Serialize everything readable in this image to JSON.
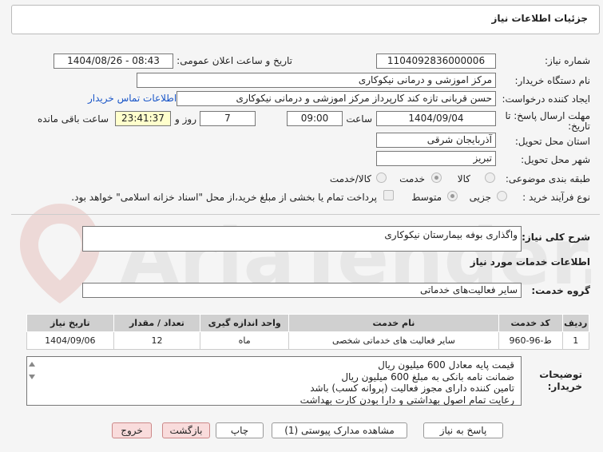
{
  "header": {
    "title": "جزئیات اطلاعات نیاز"
  },
  "form": {
    "need_number_label": "شماره نیاز:",
    "need_number": "1104092836000006",
    "announce_label": "تاریخ و ساعت اعلان عمومی:",
    "announce_value": "1404/08/26 - 08:43",
    "buyer_label": "نام دستگاه خریدار:",
    "buyer_value": "مرکز اموزشی و درمانی نیکوکاری",
    "creator_label": "ایجاد کننده درخواست:",
    "creator_value": "حسن قربانی تازه کند کارپرداز مرکز اموزشی و درمانی نیکوکاری",
    "contact_link": "اطلاعات تماس خریدار",
    "deadline_label_1": "مهلت ارسال پاسخ: تا",
    "deadline_label_2": "تاریخ:",
    "deadline_date": "1404/09/04",
    "time_label": "ساعت",
    "deadline_time": "09:00",
    "days_value": "7",
    "days_label": "روز و",
    "remaining_time": "23:41:37",
    "remaining_label": "ساعت باقی مانده",
    "province_label": "استان محل تحویل:",
    "province_value": "آذربایجان شرقی",
    "city_label": "شهر محل تحویل:",
    "city_value": "تبریز",
    "category_label": "طبقه بندی موضوعی:",
    "category_options": [
      "کالا",
      "خدمت",
      "کالا/خدمت"
    ],
    "category_selected": "خدمت",
    "process_label": "نوع فرآیند خرید :",
    "process_options": [
      "جزیی",
      "متوسط"
    ],
    "process_selected": "متوسط",
    "payment_note": "پرداخت تمام یا بخشی از مبلغ خرید،از محل \"اسناد خزانه اسلامی\" خواهد بود."
  },
  "need": {
    "summary_label": "شرح کلی نیاز:",
    "summary_value": "واگذاری بوفه بیمارستان نیکوکاری",
    "services_heading": "اطلاعات خدمات مورد نیاز",
    "group_label": "گروه خدمت:",
    "group_value": "سایر فعالیت‌های خدماتی"
  },
  "table": {
    "headers": [
      "ردیف",
      "کد خدمت",
      "نام خدمت",
      "واحد اندازه گیری",
      "تعداد / مقدار",
      "تاریخ نیاز"
    ],
    "rows": [
      [
        "1",
        "ط-96-960",
        "سایر فعالیت های خدماتی شخصی",
        "ماه",
        "12",
        "1404/09/06"
      ]
    ]
  },
  "notes": {
    "label_1": "توضیحات",
    "label_2": "خریدار:",
    "lines": [
      "قیمت پایه معادل 600 میلیون ریال",
      "ضمانت نامه بانکی به مبلغ 600 میلیون ریال",
      "تامین کننده دارای مجوز فعالیت (پروانه کسب) باشد",
      "رعایت تمام اصول بهداشتی و دارا بودن کارت بهداشت"
    ]
  },
  "buttons": {
    "reply": "پاسخ به نیاز",
    "attachments": "مشاهده مدارک پیوستی (1)",
    "print": "چاپ",
    "back": "بازگشت",
    "exit": "خروج"
  },
  "watermark": {
    "text": "AriaTender.neT"
  }
}
